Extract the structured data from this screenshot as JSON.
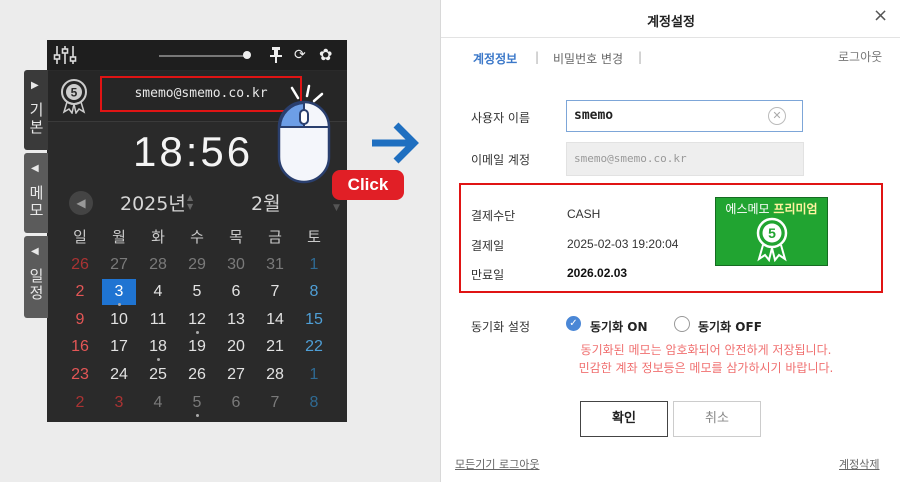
{
  "widget": {
    "email": "smemo@smemo.co.kr",
    "time": "18:56",
    "year": "2025년",
    "month": "2월",
    "side_tabs": [
      "기본",
      "메모",
      "일정"
    ],
    "weekdays": [
      "일",
      "월",
      "화",
      "수",
      "목",
      "금",
      "토"
    ],
    "weeks": [
      [
        "26",
        "27",
        "28",
        "29",
        "30",
        "31",
        "1"
      ],
      [
        "2",
        "3",
        "4",
        "5",
        "6",
        "7",
        "8"
      ],
      [
        "9",
        "10",
        "11",
        "12",
        "13",
        "14",
        "15"
      ],
      [
        "16",
        "17",
        "18",
        "19",
        "20",
        "21",
        "22"
      ],
      [
        "23",
        "24",
        "25",
        "26",
        "27",
        "28",
        "1"
      ],
      [
        "2",
        "3",
        "4",
        "5",
        "6",
        "7",
        "8"
      ]
    ],
    "selected_date": "3",
    "click_label": "Click"
  },
  "dialog": {
    "title": "계정설정",
    "close": "×",
    "tabs": [
      "계정정보",
      "비밀번호 변경"
    ],
    "logout": "로그아웃",
    "username_label": "사용자 이름",
    "username_value": "smemo",
    "email_label": "이메일 계정",
    "email_value": "smemo@smemo.co.kr",
    "payment": {
      "method_label": "결제수단",
      "method_value": "CASH",
      "date_label": "결제일",
      "date_value": "2025-02-03 19:20:04",
      "expire_label": "만료일",
      "expire_value": "2026.02.03",
      "premium_prefix": "에스메모",
      "premium_strong": "프리미엄"
    },
    "sync_label": "동기화 설정",
    "sync_on": "동기화 ON",
    "sync_off": "동기화 OFF",
    "sync_selected": "on",
    "notice_line1": "동기화된 메모는 암호화되어 안전하게 저장됩니다.",
    "notice_line2": "민감한 계좌 정보등은 메모를 삼가하시기 바랍니다.",
    "ok": "확인",
    "cancel": "취소",
    "logout_all": "모든기기 로그아웃",
    "delete_account": "계정삭제"
  },
  "colors": {
    "accent": "#3b78c9",
    "highlight_border": "#e01414",
    "premium_green": "#21a431",
    "click_red": "#e11f26",
    "arrow_blue": "#1f6fc0"
  }
}
